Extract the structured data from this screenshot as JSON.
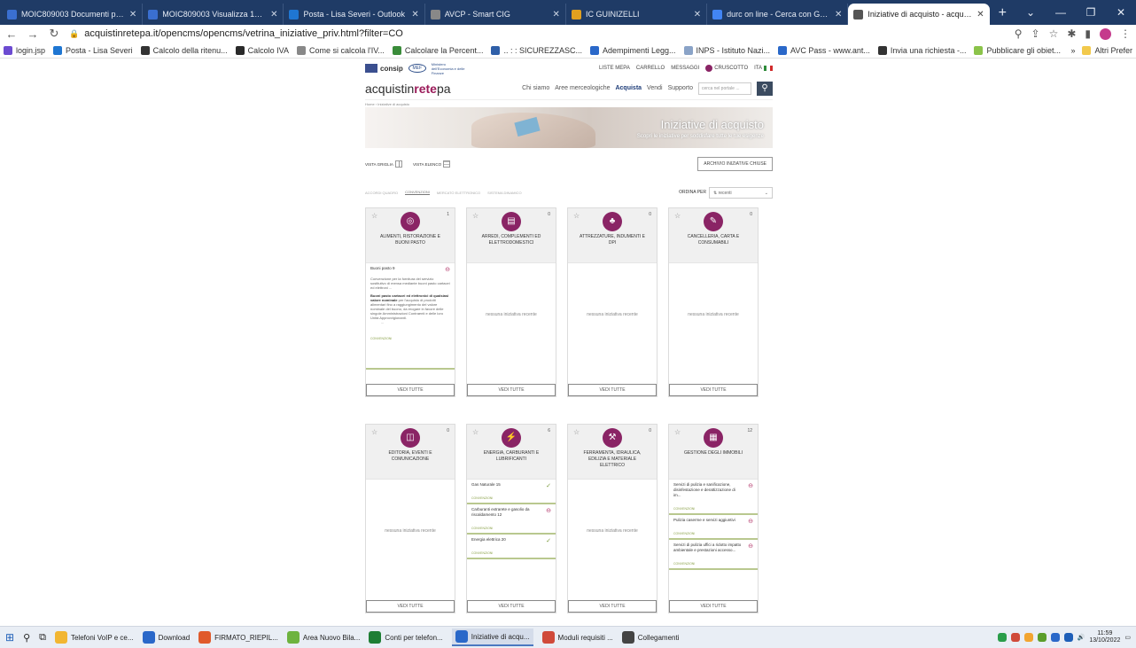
{
  "browser": {
    "tabs": [
      {
        "label": "MOIC809003 Documenti proto:",
        "color": "#3a6fd0",
        "active": false
      },
      {
        "label": "MOIC809003 Visualizza 13/10/2",
        "color": "#3a6fd0",
        "active": false
      },
      {
        "label": "Posta - Lisa Severi - Outlook",
        "color": "#1f76d2",
        "active": false
      },
      {
        "label": "AVCP - Smart CIG",
        "color": "#888888",
        "active": false
      },
      {
        "label": "IC GUINIZELLI",
        "color": "#e0a020",
        "active": false
      },
      {
        "label": "durc on line - Cerca con Google",
        "color": "#4285f4",
        "active": false
      },
      {
        "label": "Iniziative di acquisto - acquistin",
        "color": "#555555",
        "active": true
      }
    ],
    "url": "acquistinretepa.it/opencms/opencms/vetrina_iniziative_priv.html?filter=CO",
    "bookmarks": [
      "login.jsp",
      "Posta - Lisa Severi",
      "Calcolo della ritenu...",
      "Calcolo IVA",
      "Come si calcola l'IV...",
      "Calcolare la Percent...",
      ".. : : SICUREZZASC...",
      "Adempimenti Legg...",
      "INPS - Istituto Nazi...",
      "AVC Pass - www.ant...",
      "Invia una richiesta -...",
      "Pubblicare gli obiet..."
    ],
    "bookmarks_more": "»",
    "other_bookmarks": "Altri Prefer"
  },
  "site": {
    "consip": "consip",
    "mef": "MEF",
    "mef_text": "Ministero dell'Economia e delle Finanze",
    "top_links": [
      "LISTE MEPA",
      "CARRELLO",
      "MESSAGGI",
      "CRUSCOTTO",
      "ITA"
    ],
    "brand_prefix": "acquistin",
    "brand_bold": "rete",
    "brand_suffix": "pa",
    "nav": [
      "Chi siamo",
      "Aree merceologiche",
      "Acquista",
      "Vendi",
      "Supporto"
    ],
    "nav_active": "Acquista",
    "search_placeholder": "cerca nel portale ...",
    "breadcrumb": "Home  ›  Iniziative di acquisto",
    "hero_title": "Iniziative di acquisto",
    "hero_sub": "Scopri le iniziative per soddisfare tutte le tue esigenze",
    "vista_griglia": "VISTA GRIGLIA",
    "vista_elenco": "VISTA ELENCO",
    "archivio": "ARCHIVIO INIZIATIVE CHIUSE",
    "filters": [
      "ACCORDI QUADRO",
      "CONVENZIONI",
      "MERCATO ELETTRONICO",
      "SISTEMA DINAMICO"
    ],
    "filter_active": "CONVENZIONI",
    "order_label": "ORDINA PER",
    "order_value": "recenti",
    "empty_text": "nessuna iniziativa recente",
    "vedi_tutte": "VEDI TUTTE",
    "tag": "CONVENZIONI"
  },
  "cards": [
    {
      "title": "ALIMENTI, RISTORAZIONE E BUONI PASTO",
      "count": "1",
      "icon": "food-icon",
      "items": [
        {
          "title": "Buoni pasto 9",
          "status": "minus",
          "desc_pre": "Convenzione per la fornitura del servizio sostitutivo di mensa mediante buoni pasto cartacei ed elettroni ...",
          "desc_bold": "Buoni pasto cartacei ed elettronici di qualsiasi valore nominale",
          "desc_post": "per l'acquisto di prodotti alimentari fino a raggiungimento del valore nominale del buono, da erogare in favore delle singole Amministrazioni Contraenti e delle loro Unità Approvvigionanti.",
          "ellipsis": "..."
        }
      ]
    },
    {
      "title": "ARREDI, COMPLEMENTI ED ELETTRODOMESTICI",
      "count": "0",
      "icon": "furniture-icon",
      "items": []
    },
    {
      "title": "ATTREZZATURE, INDUMENTI E DPI",
      "count": "0",
      "icon": "equipment-icon",
      "items": []
    },
    {
      "title": "CANCELLERIA, CARTA E CONSUMABILI",
      "count": "0",
      "icon": "stationery-icon",
      "items": []
    },
    {
      "title": "EDITORIA, EVENTI E COMUNICAZIONE",
      "count": "0",
      "icon": "publishing-icon",
      "items": []
    },
    {
      "title": "ENERGIA, CARBURANTI E LUBRIFICANTI",
      "count": "6",
      "icon": "energy-icon",
      "items": [
        {
          "title": "Gas Naturale 15",
          "status": "ok"
        },
        {
          "title": "Carburanti extrarete e gasolio da riscaldamento 12",
          "status": "minus"
        },
        {
          "title": "Energia elettrica 20",
          "status": "ok"
        }
      ]
    },
    {
      "title": "FERRAMENTA, IDRAULICA, EDILIZIA E MATERIALE ELETTRICO",
      "count": "0",
      "icon": "hardware-icon",
      "items": []
    },
    {
      "title": "GESTIONE DEGLI IMMOBILI",
      "count": "12",
      "icon": "building-icon",
      "items": [
        {
          "title": "Servizi di pulizia e sanificazione, disinfestazione e derattizzazione di im...",
          "status": "minus"
        },
        {
          "title": "Pulizia caserme e servizi aggiuntivi",
          "status": "minus"
        },
        {
          "title": "Servizi di pulizia uffici a ridotto impatto ambientale e prestazioni accesso...",
          "status": "minus"
        }
      ]
    }
  ],
  "taskbar": {
    "items": [
      "Telefoni VoIP e ce...",
      "Download",
      "FIRMATO_RIEPIL...",
      "Area Nuovo Bila...",
      "Conti per telefon...",
      "Iniziative di acqu...",
      "Moduli requisiti ...",
      "Collegamenti"
    ],
    "time": "11:59",
    "date": "13/10/2022"
  }
}
